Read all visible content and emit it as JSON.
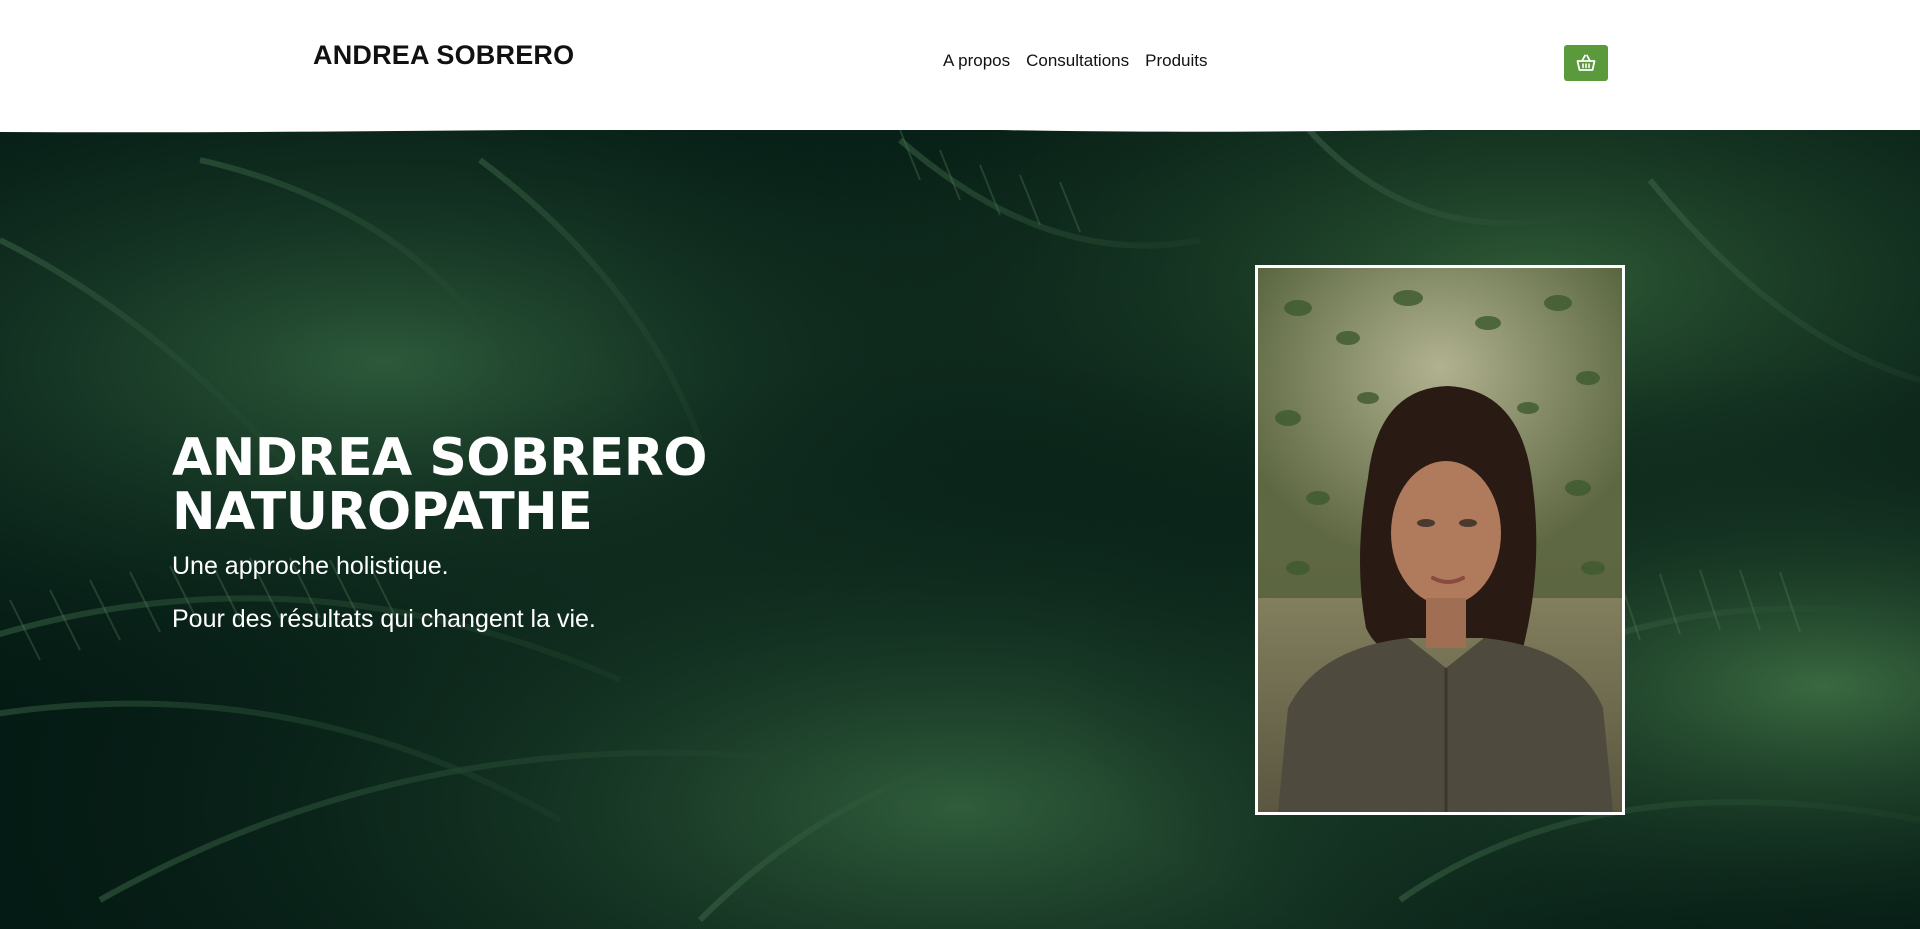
{
  "header": {
    "brand": "ANDREA SOBRERO",
    "nav": [
      {
        "label": "A propos"
      },
      {
        "label": "Consultations"
      },
      {
        "label": "Produits"
      }
    ],
    "cart_icon": "basket-icon"
  },
  "hero": {
    "title_line1": "ANDREA SOBRERO",
    "title_line2": "NATUROPATHE",
    "subtitle": "Une approche holistique.",
    "tagline": "Pour des résultats qui changent la vie.",
    "background": "palm-leaves-photo",
    "portrait": "woman-portrait-photo"
  },
  "colors": {
    "accent": "#5a9a3c",
    "hero_dark": "#041a14",
    "text_dark": "#111111",
    "white": "#ffffff"
  }
}
